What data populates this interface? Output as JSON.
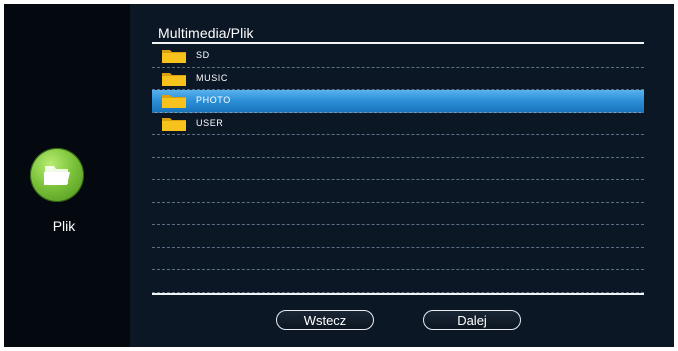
{
  "sidebar": {
    "icon": "folder-icon",
    "label": "Plik"
  },
  "header": {
    "title": "Multimedia/Plik"
  },
  "list": {
    "items": [
      {
        "label": "SD",
        "icon": "folder-icon",
        "selected": false
      },
      {
        "label": "MUSIC",
        "icon": "folder-icon",
        "selected": false
      },
      {
        "label": "PHOTO",
        "icon": "folder-icon",
        "selected": true
      },
      {
        "label": "USER",
        "icon": "folder-icon",
        "selected": false
      },
      {
        "label": ""
      },
      {
        "label": ""
      },
      {
        "label": ""
      },
      {
        "label": ""
      },
      {
        "label": ""
      },
      {
        "label": ""
      },
      {
        "label": ""
      }
    ]
  },
  "buttons": {
    "back_label": "Wstecz",
    "next_label": "Dalej"
  },
  "colors": {
    "accent_selected": "#2b8ed6",
    "sidebar_icon": "#7cc33a",
    "folder": "#f7c21c",
    "background": "#0c1726"
  }
}
